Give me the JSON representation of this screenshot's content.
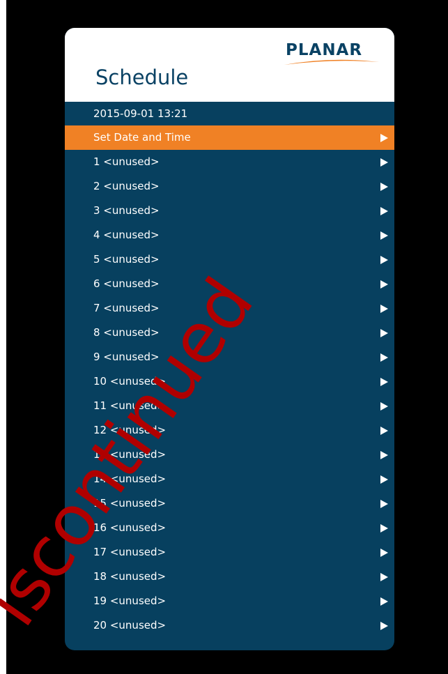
{
  "brand": {
    "logo_text": "PLANAR",
    "logo_swoosh_icon": "swoosh-icon"
  },
  "header": {
    "title": "Schedule"
  },
  "status": {
    "datetime": "2015-09-01 13:21"
  },
  "menu": {
    "set_date_time": {
      "label": "Set Date and Time",
      "selected": true
    },
    "items": [
      "1 <unused>",
      "2 <unused>",
      "3 <unused>",
      "4 <unused>",
      "5 <unused>",
      "6 <unused>",
      "7 <unused>",
      "8 <unused>",
      "9 <unused>",
      "10 <unused>",
      "11 <unused>",
      "12 <unused>",
      "13 <unused>",
      "14 <unused>",
      "15 <unused>",
      "16 <unused>",
      "17 <unused>",
      "18 <unused>",
      "19 <unused>",
      "20 <unused>"
    ],
    "arrow_icon": "triangle-right-icon"
  },
  "watermark": {
    "text": "iscontinued",
    "color": "#b00000"
  },
  "colors": {
    "panel": "#07405f",
    "accent": "#f08125",
    "brand": "#0a4264"
  }
}
